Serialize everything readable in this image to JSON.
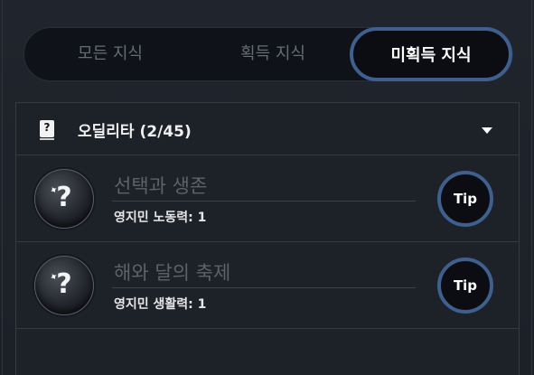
{
  "tabs": [
    {
      "label": "모든 지식",
      "active": false
    },
    {
      "label": "획득 지식",
      "active": false
    },
    {
      "label": "미획득 지식",
      "active": true
    }
  ],
  "section": {
    "icon": "book-question-icon",
    "icon_glyph": "?",
    "title": "오딜리타 (2/45)",
    "caret_icon": "caret-down-icon"
  },
  "items": [
    {
      "icon": "question-orb-icon",
      "icon_glyph": "?",
      "title": "선택과 생존",
      "subtitle": "영지민 노동력: 1",
      "tip_label": "Tip"
    },
    {
      "icon": "question-orb-icon",
      "icon_glyph": "?",
      "title": "해와 달의 축제",
      "subtitle": "영지민 생활력: 1",
      "tip_label": "Tip"
    }
  ],
  "colors": {
    "accent_ring": "#3f5f8f",
    "background": "#1d2128",
    "muted_text": "#5c616b"
  }
}
